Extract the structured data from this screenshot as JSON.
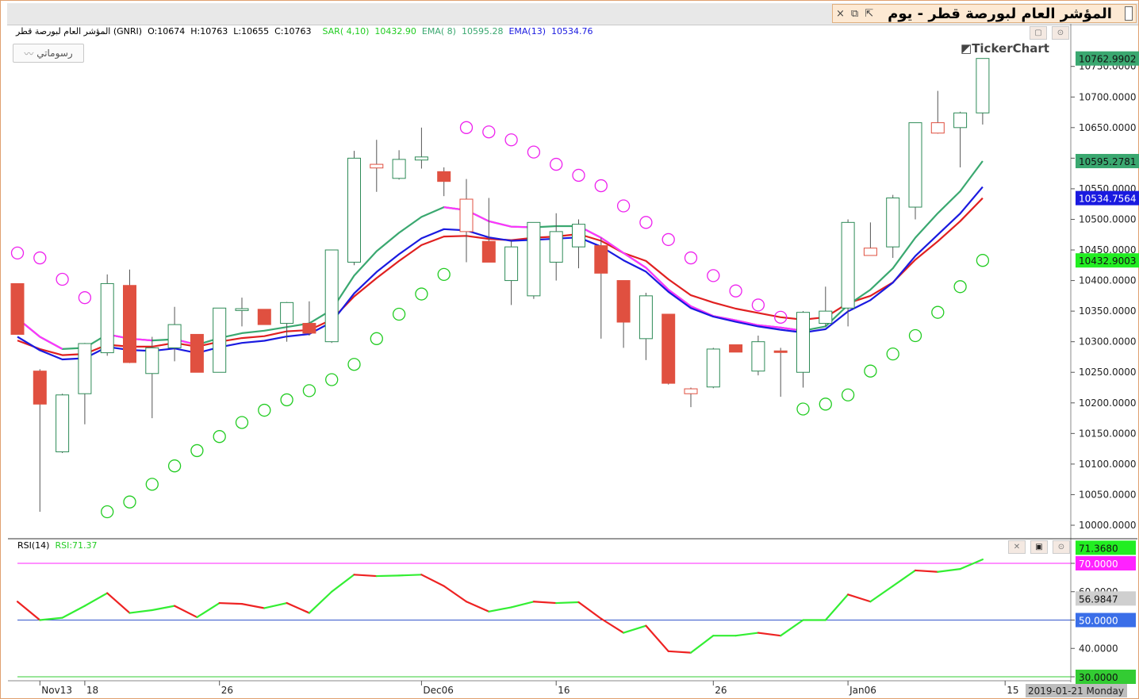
{
  "window": {
    "title": "المؤشر العام لبورصة قطر - يوم",
    "controls": [
      "×",
      "⧉",
      "⇱"
    ]
  },
  "header": {
    "symbol": "المؤشر العام لبورصة قطر (GNRI)",
    "open": "O:10674",
    "high": "H:10763",
    "low": "L:10655",
    "close": "C:10763",
    "sar_label": "SAR( 4,10)",
    "sar_value": "10432.90",
    "ema8_label": "EMA( 8)",
    "ema8_value": "10595.28",
    "ema13_label": "EMA(13)",
    "ema13_value": "10534.76"
  },
  "drawings_button": "رسوماتي",
  "brand": "TickerChart",
  "rsi_header": {
    "label": "RSI(14)",
    "value": "RSI:71.37"
  },
  "colors": {
    "up": "#2e8b57",
    "down": "#e05040",
    "sar": "#22cc22",
    "sar_down": "#ee22ee",
    "ema8": "#e02020",
    "ema13": "#1a1ae0",
    "ema_magenta": "#ff33ff",
    "ema_green": "#3aa870",
    "rsi_up": "#33ee33",
    "rsi_down": "#ee2222"
  },
  "chart_data": [
    {
      "type": "candlestick",
      "ylim": [
        9990,
        10780
      ],
      "y_ticks": [
        "10000.0000",
        "10050.0000",
        "10100.0000",
        "10150.0000",
        "10200.0000",
        "10250.0000",
        "10300.0000",
        "10350.0000",
        "10400.0000",
        "10450.0000",
        "10500.0000",
        "10550.0000",
        "10600.0000",
        "10650.0000",
        "10700.0000",
        "10750.0000"
      ],
      "x_labels": [
        {
          "i": 1,
          "label": "Nov13"
        },
        {
          "i": 3,
          "label": "18"
        },
        {
          "i": 9,
          "label": "26"
        },
        {
          "i": 18,
          "label": "Dec06"
        },
        {
          "i": 24,
          "label": "16"
        },
        {
          "i": 31,
          "label": "26"
        },
        {
          "i": 37,
          "label": "Jan06"
        },
        {
          "i": 44,
          "label": "15"
        }
      ],
      "date_badge": "2019-01-21 Monday",
      "candles": [
        {
          "o": 10395,
          "h": 10395,
          "l": 10312,
          "c": 10312
        },
        {
          "o": 10252,
          "h": 10255,
          "l": 10022,
          "c": 10198
        },
        {
          "o": 10120,
          "h": 10215,
          "l": 10118,
          "c": 10213
        },
        {
          "o": 10215,
          "h": 10298,
          "l": 10165,
          "c": 10297
        },
        {
          "o": 10282,
          "h": 10410,
          "l": 10277,
          "c": 10395
        },
        {
          "o": 10392,
          "h": 10418,
          "l": 10265,
          "c": 10266
        },
        {
          "o": 10248,
          "h": 10308,
          "l": 10175,
          "c": 10290
        },
        {
          "o": 10290,
          "h": 10357,
          "l": 10268,
          "c": 10328
        },
        {
          "o": 10312,
          "h": 10312,
          "l": 10250,
          "c": 10250
        },
        {
          "o": 10250,
          "h": 10355,
          "l": 10250,
          "c": 10355
        },
        {
          "o": 10351,
          "h": 10372,
          "l": 10325,
          "c": 10354
        },
        {
          "o": 10353,
          "h": 10353,
          "l": 10328,
          "c": 10328
        },
        {
          "o": 10330,
          "h": 10365,
          "l": 10300,
          "c": 10364
        },
        {
          "o": 10330,
          "h": 10366,
          "l": 10310,
          "c": 10314
        },
        {
          "o": 10300,
          "h": 10450,
          "l": 10298,
          "c": 10450
        },
        {
          "o": 10430,
          "h": 10612,
          "l": 10425,
          "c": 10600
        },
        {
          "o": 10590,
          "h": 10630,
          "l": 10545,
          "c": 10584
        },
        {
          "o": 10567,
          "h": 10613,
          "l": 10565,
          "c": 10598
        },
        {
          "o": 10597,
          "h": 10650,
          "l": 10583,
          "c": 10602
        },
        {
          "o": 10578,
          "h": 10585,
          "l": 10538,
          "c": 10562
        },
        {
          "o": 10533,
          "h": 10566,
          "l": 10430,
          "c": 10480
        },
        {
          "o": 10464,
          "h": 10535,
          "l": 10430,
          "c": 10430
        },
        {
          "o": 10400,
          "h": 10465,
          "l": 10360,
          "c": 10455
        },
        {
          "o": 10375,
          "h": 10495,
          "l": 10370,
          "c": 10495
        },
        {
          "o": 10430,
          "h": 10510,
          "l": 10400,
          "c": 10480
        },
        {
          "o": 10455,
          "h": 10500,
          "l": 10420,
          "c": 10492
        },
        {
          "o": 10457,
          "h": 10470,
          "l": 10305,
          "c": 10412
        },
        {
          "o": 10400,
          "h": 10400,
          "l": 10290,
          "c": 10332
        },
        {
          "o": 10305,
          "h": 10380,
          "l": 10270,
          "c": 10375
        },
        {
          "o": 10345,
          "h": 10345,
          "l": 10230,
          "c": 10232
        },
        {
          "o": 10223,
          "h": 10225,
          "l": 10193,
          "c": 10215
        },
        {
          "o": 10226,
          "h": 10290,
          "l": 10224,
          "c": 10288
        },
        {
          "o": 10295,
          "h": 10295,
          "l": 10283,
          "c": 10283
        },
        {
          "o": 10252,
          "h": 10310,
          "l": 10245,
          "c": 10300
        },
        {
          "o": 10285,
          "h": 10290,
          "l": 10210,
          "c": 10283
        },
        {
          "o": 10250,
          "h": 10350,
          "l": 10225,
          "c": 10348
        },
        {
          "o": 10330,
          "h": 10390,
          "l": 10325,
          "c": 10350
        },
        {
          "o": 10355,
          "h": 10500,
          "l": 10325,
          "c": 10495
        },
        {
          "o": 10453,
          "h": 10495,
          "l": 10442,
          "c": 10441
        },
        {
          "o": 10455,
          "h": 10540,
          "l": 10437,
          "c": 10535
        },
        {
          "o": 10520,
          "h": 10658,
          "l": 10500,
          "c": 10658
        },
        {
          "o": 10658,
          "h": 10710,
          "l": 10640,
          "c": 10641
        },
        {
          "o": 10650,
          "h": 10676,
          "l": 10585,
          "c": 10674
        },
        {
          "o": 10674,
          "h": 10763,
          "l": 10655,
          "c": 10763
        }
      ],
      "sar": [
        10445,
        10437,
        10402,
        10372,
        10022,
        10038,
        10067,
        10097,
        10122,
        10145,
        10168,
        10188,
        10205,
        10220,
        10238,
        10263,
        10305,
        10345,
        10378,
        10410,
        10650,
        10643,
        10630,
        10610,
        10590,
        10572,
        10555,
        10522,
        10495,
        10467,
        10437,
        10408,
        10383,
        10360,
        10340,
        10190,
        10198,
        10213,
        10252,
        10280,
        10310,
        10348,
        10390,
        10432.9
      ],
      "sar_color": [
        "d",
        "d",
        "d",
        "d",
        "u",
        "u",
        "u",
        "u",
        "u",
        "u",
        "u",
        "u",
        "u",
        "u",
        "u",
        "u",
        "u",
        "u",
        "u",
        "u",
        "d",
        "d",
        "d",
        "d",
        "d",
        "d",
        "d",
        "d",
        "d",
        "d",
        "d",
        "d",
        "d",
        "d",
        "d",
        "u",
        "u",
        "u",
        "u",
        "u",
        "u",
        "u",
        "u",
        "u"
      ],
      "ema8_line": [
        10302,
        10288,
        10278,
        10280,
        10295,
        10292,
        10292,
        10298,
        10292,
        10300,
        10306,
        10309,
        10317,
        10319,
        10336,
        10374,
        10404,
        10432,
        10458,
        10472,
        10473,
        10468,
        10466,
        10470,
        10472,
        10476,
        10465,
        10445,
        10432,
        10402,
        10376,
        10364,
        10354,
        10347,
        10340,
        10336,
        10340,
        10363,
        10375,
        10397,
        10434,
        10464,
        10497,
        10534.76
      ],
      "ema13_line": [
        10338,
        10308,
        10288,
        10290,
        10312,
        10305,
        10302,
        10304,
        10295,
        10306,
        10314,
        10318,
        10324,
        10330,
        10352,
        10408,
        10448,
        10478,
        10504,
        10520,
        10515,
        10497,
        10488,
        10487,
        10489,
        10489,
        10470,
        10445,
        10421,
        10385,
        10358,
        10342,
        10335,
        10327,
        10323,
        10318,
        10325,
        10360,
        10385,
        10420,
        10470,
        10510,
        10546,
        10595.28
      ],
      "last_values": {
        "close": "10762.9902",
        "ema13": "10595.2781",
        "ema8": "10534.7564",
        "sar": "10432.9003"
      }
    },
    {
      "type": "line",
      "title": "RSI(14)",
      "ylim": [
        28,
        75
      ],
      "y_ticks": [
        "30.0000",
        "40.0000",
        "50.0000",
        "60.0000",
        "70.0000"
      ],
      "rsi": [
        56.5,
        50,
        50.8,
        55,
        59.5,
        52.5,
        53.5,
        55,
        51,
        56,
        55.7,
        54.2,
        56,
        52.5,
        60,
        66,
        65.5,
        65.7,
        66,
        62,
        56.5,
        53,
        54.5,
        56.5,
        56,
        56.3,
        50.5,
        45.5,
        48,
        39,
        38.5,
        44.5,
        44.5,
        45.5,
        44.5,
        50,
        50,
        59,
        56.5,
        62,
        67.5,
        67,
        68,
        71.37
      ],
      "levels": {
        "upper": 70,
        "middle": 50,
        "lower": 30
      },
      "last_values": {
        "rsi": "71.3680",
        "upper": "70.0000",
        "prev": "56.9847",
        "middle": "50.0000",
        "lower": "30.0000"
      }
    }
  ]
}
